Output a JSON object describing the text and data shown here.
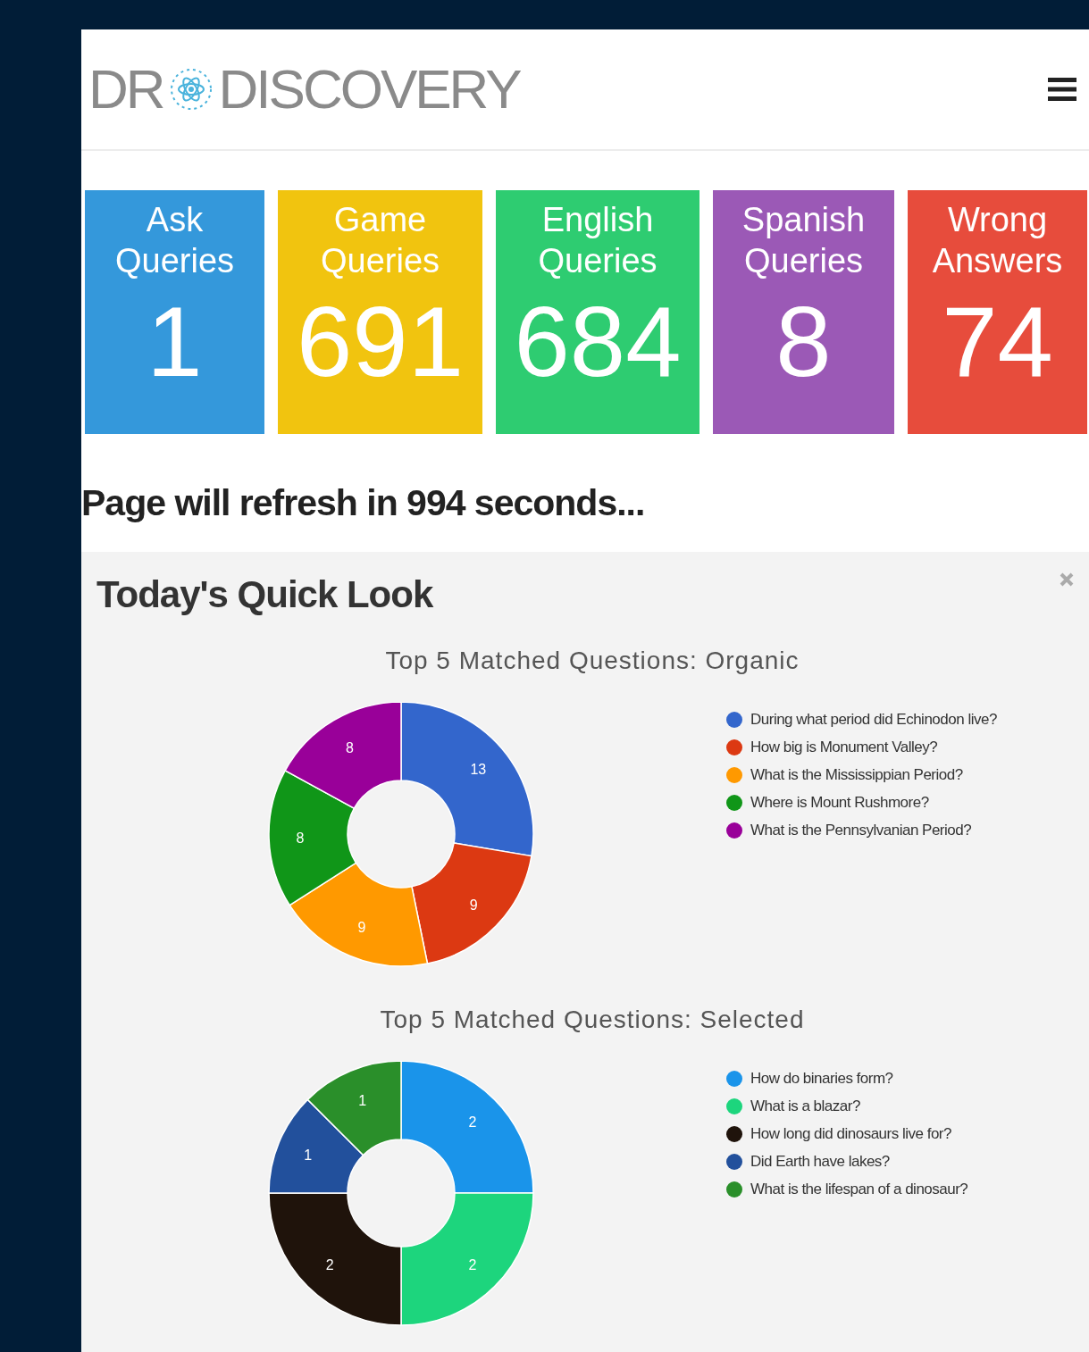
{
  "logo": {
    "left": "DR",
    "right": "DISCOVERY"
  },
  "tiles": [
    {
      "title": "Ask Queries",
      "count": "1",
      "color": "#3498db"
    },
    {
      "title": "Game Queries",
      "count": "691",
      "color": "#f1c40f"
    },
    {
      "title": "English Queries",
      "count": "684",
      "color": "#2ecc71"
    },
    {
      "title": "Spanish Queries",
      "count": "8",
      "color": "#9b59b6"
    },
    {
      "title": "Wrong Answers",
      "count": "74",
      "color": "#e74c3c"
    }
  ],
  "refresh_notice": "Page will refresh in 994 seconds...",
  "panel": {
    "title": "Today's Quick Look",
    "charts": [
      {
        "chart_data": {
          "type": "donut",
          "title": "Top 5 Matched Questions: Organic",
          "categories": [
            "During what period did Echinodon live?",
            "How big is Monument Valley?",
            "What is the Mississippian Period?",
            "Where is Mount Rushmore?",
            "What is the Pennsylvanian Period?"
          ],
          "values": [
            13,
            9,
            9,
            8,
            8
          ],
          "colors": [
            "#3366cc",
            "#dc3912",
            "#ff9900",
            "#109618",
            "#990099"
          ],
          "data_labels": true
        }
      },
      {
        "chart_data": {
          "type": "donut",
          "title": "Top 5 Matched Questions: Selected",
          "categories": [
            "How do binaries form?",
            "What is a blazar?",
            "How long did dinosaurs live for?",
            "Did Earth have lakes?",
            "What is the lifespan of a dinosaur?"
          ],
          "values": [
            2,
            2,
            2,
            1,
            1
          ],
          "colors": [
            "#1a94ea",
            "#1dd57d",
            "#1f130b",
            "#22509c",
            "#2a8f2a"
          ],
          "data_labels": true
        }
      }
    ]
  }
}
